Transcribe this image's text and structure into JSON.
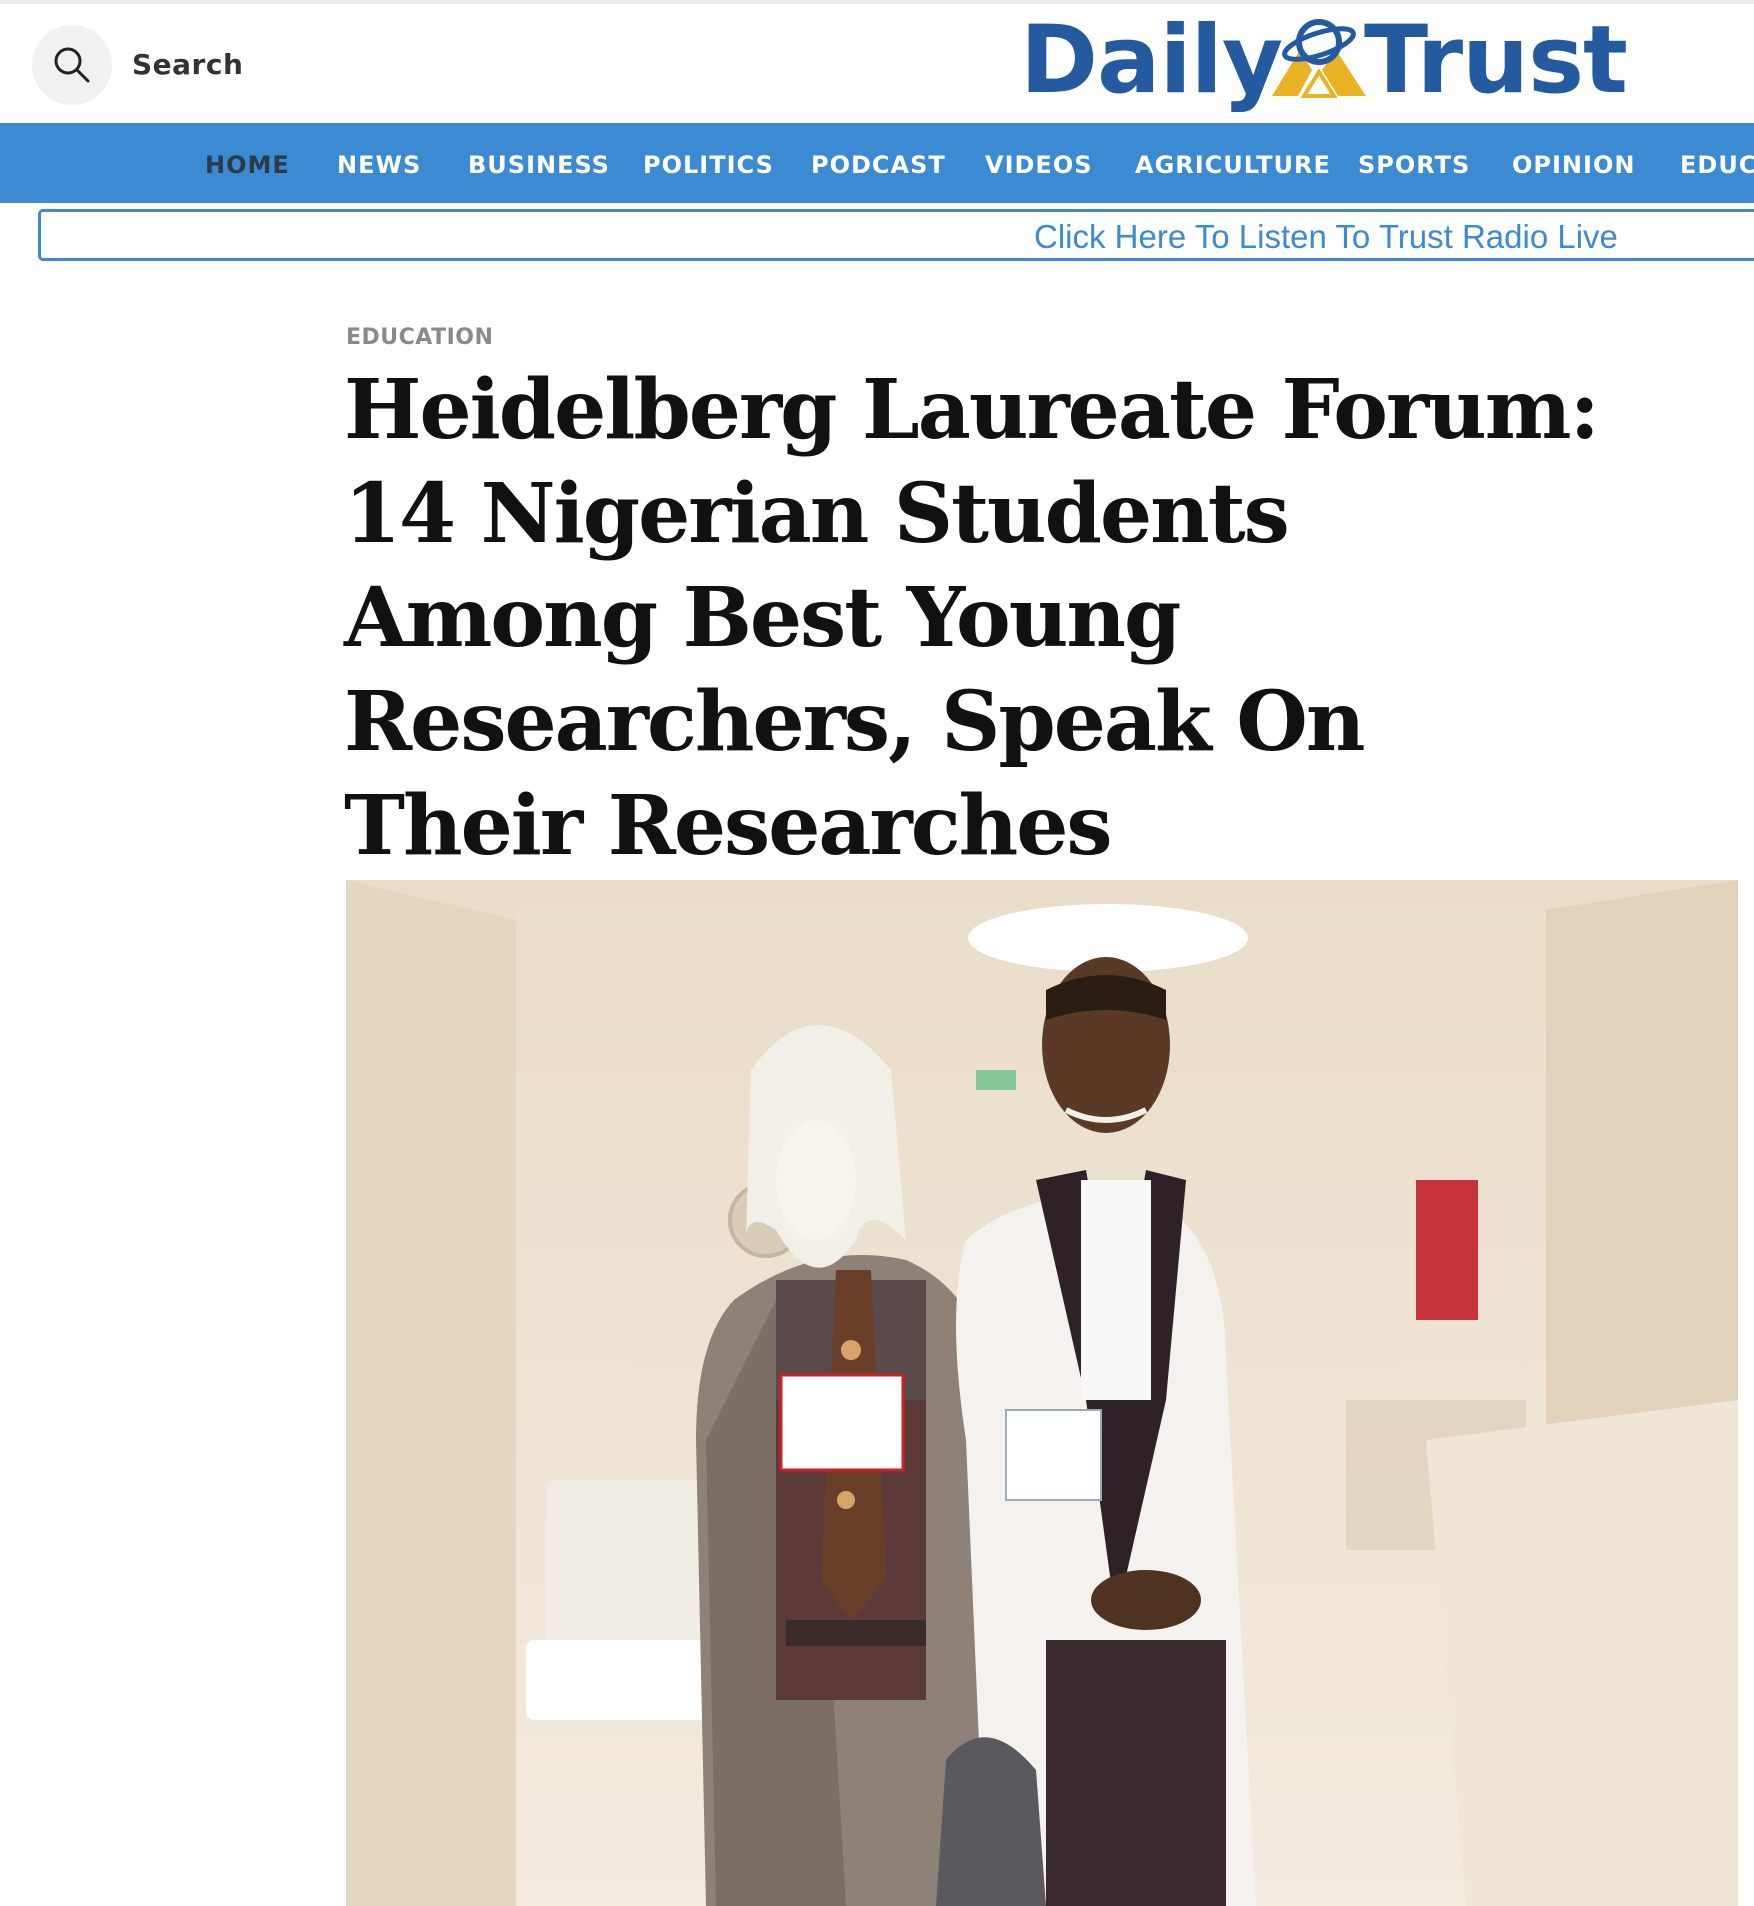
{
  "header": {
    "search_label": "Search",
    "logo": {
      "left_word": "Daily",
      "right_word": "Trust",
      "brand_color": "#245aa0",
      "accent_color": "#e8b224"
    }
  },
  "nav": {
    "items": [
      "HOME",
      "NEWS",
      "BUSINESS",
      "POLITICS",
      "PODCAST",
      "VIDEOS",
      "AGRICULTURE",
      "SPORTS",
      "OPINION",
      "EDUCA"
    ],
    "active": "HOME",
    "bar_color": "#3b8ad2"
  },
  "radio_banner": {
    "text": "Click Here To Listen To Trust Radio Live"
  },
  "article": {
    "category": "EDUCATION",
    "headline": "Heidelberg Laureate Forum: 14 Nigerian Students Among Best Young Researchers, Speak On Their Researches"
  },
  "icons": {
    "search": "search-icon",
    "logo_mark": "globe-triangle-logo-icon"
  }
}
